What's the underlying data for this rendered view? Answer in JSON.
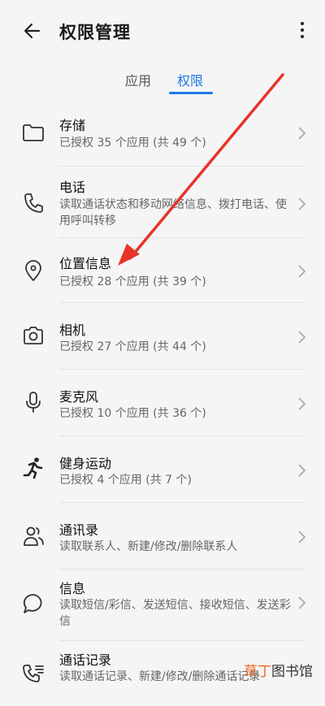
{
  "header": {
    "title": "权限管理"
  },
  "tabs": {
    "apps": "应用",
    "permissions": "权限"
  },
  "permissions": [
    {
      "name": "存储",
      "desc": "已授权 35 个应用 (共 49 个)",
      "icon": "folder-icon"
    },
    {
      "name": "电话",
      "desc": "读取通话状态和移动网络信息、拨打电话、使用呼叫转移",
      "icon": "phone-icon"
    },
    {
      "name": "位置信息",
      "desc": "已授权 28 个应用 (共 39 个)",
      "icon": "location-pin-icon"
    },
    {
      "name": "相机",
      "desc": "已授权 27 个应用 (共 44 个)",
      "icon": "camera-icon"
    },
    {
      "name": "麦克风",
      "desc": "已授权 10 个应用 (共 36 个)",
      "icon": "microphone-icon"
    },
    {
      "name": "健身运动",
      "desc": "已授权 4 个应用 (共 7 个)",
      "icon": "running-icon"
    },
    {
      "name": "通讯录",
      "desc": "读取联系人、新建/修改/删除联系人",
      "icon": "contacts-icon"
    },
    {
      "name": "信息",
      "desc": "读取短信/彩信、发送短信、接收短信、发送彩信",
      "icon": "message-icon"
    },
    {
      "name": "通话记录",
      "desc": "读取通话记录、新建/修改/删除通话记录",
      "icon": "call-log-icon"
    }
  ],
  "watermark": {
    "part1": "草丁",
    "part2": "图书馆"
  },
  "colors": {
    "accent": "#1e78e6",
    "annotation_arrow": "#e8332a"
  }
}
